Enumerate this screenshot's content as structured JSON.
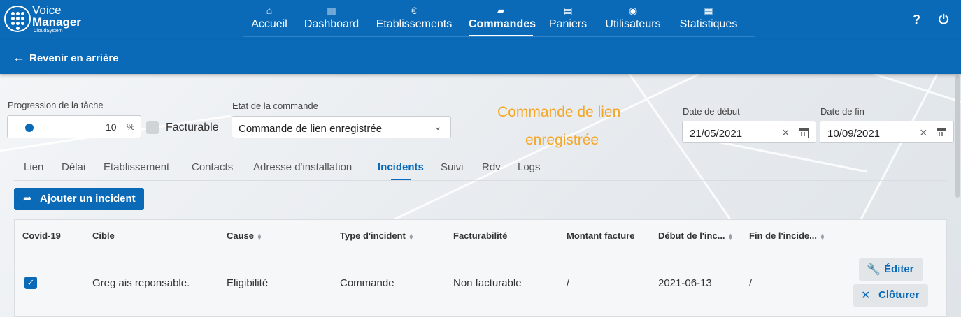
{
  "app": {
    "logo_line1": "Voice",
    "logo_line2": "Manager",
    "logo_line3": "CloudSystem"
  },
  "nav": [
    {
      "icon": "⌂",
      "label": "Accueil"
    },
    {
      "icon": "▥",
      "label": "Dashboard"
    },
    {
      "icon": "€",
      "label": "Etablissements"
    },
    {
      "icon": "▰",
      "label": "Commandes",
      "active": true
    },
    {
      "icon": "▤",
      "label": "Paniers"
    },
    {
      "icon": "◉",
      "label": "Utilisateurs"
    },
    {
      "icon": "▦",
      "label": "Statistiques"
    }
  ],
  "header_actions": {
    "help": "?",
    "power": "⏻"
  },
  "back": {
    "label": "Revenir en arrière",
    "icon": "←"
  },
  "form": {
    "progress_label": "Progression de la tâche",
    "progress_value": "10",
    "progress_unit": "%",
    "progress_fraction": 0.1,
    "billable_label": "Facturable",
    "state_label": "Etat de la commande",
    "state_value": "Commande de lien enregistrée",
    "headline_line1": "Commande de lien",
    "headline_line2": "enregistrée",
    "start_label": "Date de début",
    "start_value": "21/05/2021",
    "end_label": "Date de fin",
    "end_value": "10/09/2021"
  },
  "tabs": [
    "Lien",
    "Délai",
    "Etablissement",
    "Contacts",
    "Adresse d'installation",
    "Incidents",
    "Suivi",
    "Rdv",
    "Logs"
  ],
  "active_tab": "Incidents",
  "add_button": "Ajouter un incident",
  "table": {
    "headers": [
      "Covid-19",
      "Cible",
      "Cause",
      "Type d'incident",
      "Facturabilité",
      "Montant facture",
      "Début de l'inc...",
      "Fin de l'incide..."
    ],
    "row": {
      "covid": true,
      "cible": "Greg ais reponsable.",
      "cause": "Eligibilité",
      "type": "Commande",
      "facturabilite": "Non facturable",
      "montant": "/",
      "debut": "2021-06-13",
      "fin": "/"
    },
    "edit_label": "Éditer",
    "close_label": "Clôturer"
  },
  "colors": {
    "primary": "#0a6ab8",
    "headline": "#f5a623"
  }
}
